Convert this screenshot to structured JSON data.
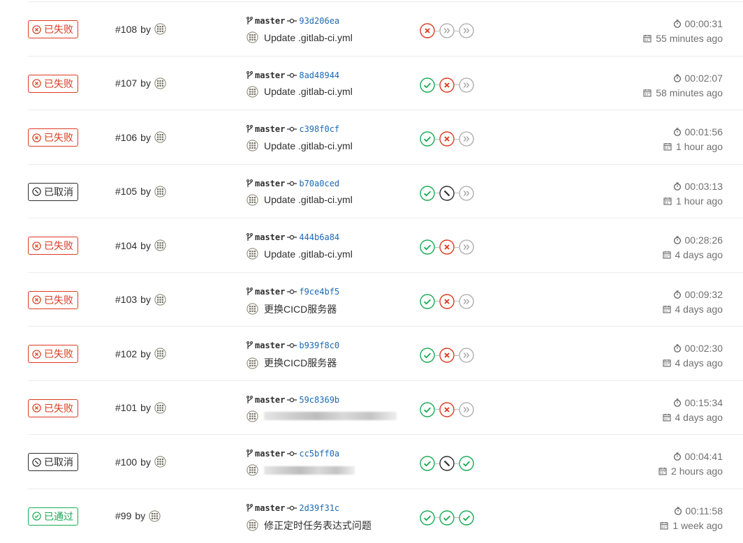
{
  "pipelines": [
    {
      "status": "failed",
      "status_label": "已失败",
      "id": "#108",
      "by": "by",
      "branch": "master",
      "sha": "93d206ea",
      "message": "Update .gitlab-ci.yml",
      "message_blurred": false,
      "stages": [
        "failed",
        "skipped",
        "skipped"
      ],
      "duration": "00:00:31",
      "finished_ago": "55 minutes ago"
    },
    {
      "status": "failed",
      "status_label": "已失败",
      "id": "#107",
      "by": "by",
      "branch": "master",
      "sha": "8ad48944",
      "message": "Update .gitlab-ci.yml",
      "message_blurred": false,
      "stages": [
        "success",
        "failed",
        "skipped"
      ],
      "duration": "00:02:07",
      "finished_ago": "58 minutes ago"
    },
    {
      "status": "failed",
      "status_label": "已失败",
      "id": "#106",
      "by": "by",
      "branch": "master",
      "sha": "c398f0cf",
      "message": "Update .gitlab-ci.yml",
      "message_blurred": false,
      "stages": [
        "success",
        "failed",
        "skipped"
      ],
      "duration": "00:01:56",
      "finished_ago": "1 hour ago"
    },
    {
      "status": "canceled",
      "status_label": "已取消",
      "id": "#105",
      "by": "by",
      "branch": "master",
      "sha": "b70a0ced",
      "message": "Update .gitlab-ci.yml",
      "message_blurred": false,
      "stages": [
        "success",
        "canceled",
        "skipped"
      ],
      "duration": "00:03:13",
      "finished_ago": "1 hour ago"
    },
    {
      "status": "failed",
      "status_label": "已失败",
      "id": "#104",
      "by": "by",
      "branch": "master",
      "sha": "444b6a84",
      "message": "Update .gitlab-ci.yml",
      "message_blurred": false,
      "stages": [
        "success",
        "failed",
        "skipped"
      ],
      "duration": "00:28:26",
      "finished_ago": "4 days ago"
    },
    {
      "status": "failed",
      "status_label": "已失败",
      "id": "#103",
      "by": "by",
      "branch": "master",
      "sha": "f9ce4bf5",
      "message": "更换CICD服务器",
      "message_blurred": false,
      "stages": [
        "success",
        "failed",
        "skipped"
      ],
      "duration": "00:09:32",
      "finished_ago": "4 days ago"
    },
    {
      "status": "failed",
      "status_label": "已失败",
      "id": "#102",
      "by": "by",
      "branch": "master",
      "sha": "b939f8c0",
      "message": "更换CICD服务器",
      "message_blurred": false,
      "stages": [
        "success",
        "failed",
        "skipped"
      ],
      "duration": "00:02:30",
      "finished_ago": "4 days ago"
    },
    {
      "status": "failed",
      "status_label": "已失败",
      "id": "#101",
      "by": "by",
      "branch": "master",
      "sha": "59c8369b",
      "message": "",
      "message_blurred": true,
      "stages": [
        "success",
        "failed",
        "skipped"
      ],
      "duration": "00:15:34",
      "finished_ago": "4 days ago"
    },
    {
      "status": "canceled",
      "status_label": "已取消",
      "id": "#100",
      "by": "by",
      "branch": "master",
      "sha": "cc5bff0a",
      "message": "",
      "message_blurred": true,
      "stages": [
        "success",
        "canceled",
        "success"
      ],
      "duration": "00:04:41",
      "finished_ago": "2 hours ago"
    },
    {
      "status": "passed",
      "status_label": "已通过",
      "id": "#99",
      "by": "by",
      "branch": "master",
      "sha": "2d39f31c",
      "message": "修正定时任务表达式问题",
      "message_blurred": false,
      "stages": [
        "success",
        "success",
        "success"
      ],
      "duration": "00:11:58",
      "finished_ago": "1 week ago"
    }
  ],
  "colors": {
    "failed": "#db3b21",
    "success": "#1aaa55",
    "canceled": "#2e2e2e",
    "skipped": "#a7a7a7",
    "link": "#1b69b6",
    "muted": "#707070"
  },
  "icons": {
    "status_failed": "circle-x-icon",
    "status_canceled": "circle-slash-icon",
    "status_passed": "circle-check-icon",
    "branch": "branch-icon",
    "commit": "commit-icon",
    "timer": "timer-icon",
    "calendar": "calendar-icon"
  }
}
